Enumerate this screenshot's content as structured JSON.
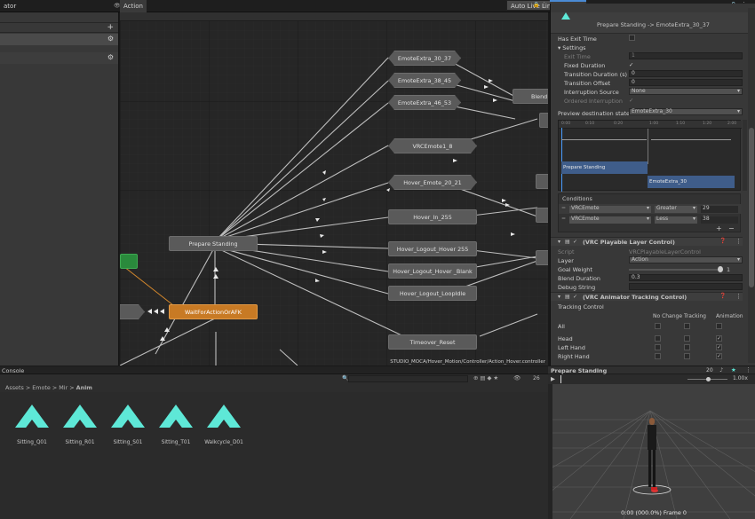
{
  "topbar": {
    "left_tab": "ator",
    "graph_tab": "Action",
    "auto_live_link": "Auto Live Link",
    "inspector_tab": "Inspector"
  },
  "graph": {
    "footer_path": "STUDIO_MOCA/Hover_Motion/Controller/Action_Hover.controller",
    "nodes": [
      {
        "label": "EmoteExtra_30_37",
        "style": "hex"
      },
      {
        "label": "EmoteExtra_38_45",
        "style": "hex"
      },
      {
        "label": "EmoteExtra_46_53",
        "style": "hex"
      },
      {
        "label": "VRCEmote1_8",
        "style": "hex"
      },
      {
        "label": "Hover_Emote_20_21",
        "style": "hex"
      },
      {
        "label": "Hover_In_255",
        "style": "state"
      },
      {
        "label": "Hover_Logout_Hover 255",
        "style": "state"
      },
      {
        "label": "Hover_Logout_Hover _Blank",
        "style": "state"
      },
      {
        "label": "Hover_Logout_LoopIdle",
        "style": "state"
      },
      {
        "label": "Prepare Standing",
        "style": "state"
      },
      {
        "label": "WaitForActionOrAFK",
        "style": "default"
      },
      {
        "label": "Timeover_Reset",
        "style": "state"
      },
      {
        "label": "Blend",
        "style": "state"
      }
    ]
  },
  "inspector": {
    "transition_title": "Prepare Standing -> EmoteExtra_30_37",
    "has_exit_time": "Has Exit Time",
    "settings": "Settings",
    "rows": [
      {
        "label": "Exit Time",
        "value": "1"
      },
      {
        "label": "Fixed Duration",
        "value": "✓"
      },
      {
        "label": "Transition Duration (s)",
        "value": "0"
      },
      {
        "label": "Transition Offset",
        "value": "0"
      },
      {
        "label": "Interruption Source",
        "value": "None"
      },
      {
        "label": "Ordered Interruption",
        "value": "✓"
      }
    ],
    "preview_label": "Preview destination state",
    "preview_value": "EmoteExtra_30",
    "timeline_ticks": [
      "0:00",
      "0:10",
      "0:20",
      "1:00",
      "1:10",
      "1:20",
      "2:00"
    ],
    "timeline_clips": [
      "Prepare Standing",
      "EmoteExtra_30"
    ],
    "conditions_title": "Conditions",
    "conditions": [
      {
        "param": "VRCEmote",
        "op": "Greater",
        "value": "29"
      },
      {
        "param": "VRCEmote",
        "op": "Less",
        "value": "38"
      }
    ],
    "playable_component": "(VRC Playable Layer Control)",
    "script_label": "Script",
    "script_value": "VRCPlayableLayerControl",
    "layer_label": "Layer",
    "layer_value": "Action",
    "goal_weight_label": "Goal Weight",
    "goal_weight_value": "1",
    "goal_weight_fraction": 1,
    "blend_label": "Blend Duration",
    "blend_value": "0.3",
    "debug_label": "Debug String",
    "tracking_component": "(VRC Animator Tracking Control)",
    "tracking_title": "Tracking Control",
    "tracking_columns": [
      "No Change",
      "Tracking",
      "Animation"
    ],
    "tracking_rows": [
      "All",
      "Head",
      "Left Hand",
      "Right Hand"
    ]
  },
  "project": {
    "console_tab": "Console",
    "count": "26",
    "breadcrumb": [
      "Assets",
      "Emote",
      "Mir",
      "Anim"
    ],
    "assets": [
      "Sitting_Q01",
      "Sitting_R01",
      "Sitting_S01",
      "Sitting_T01",
      "Walkcycle_D01"
    ]
  },
  "scene": {
    "title": "Prepare Standing",
    "speed_value": "20",
    "playback": "1.00x",
    "frame_info": "0:00 (000.0%) Frame 0"
  },
  "colors": {
    "accent": "#d3872c",
    "hover_node": "#595959",
    "clip": "#3f5d8a",
    "teal": "#5ee8d7"
  }
}
